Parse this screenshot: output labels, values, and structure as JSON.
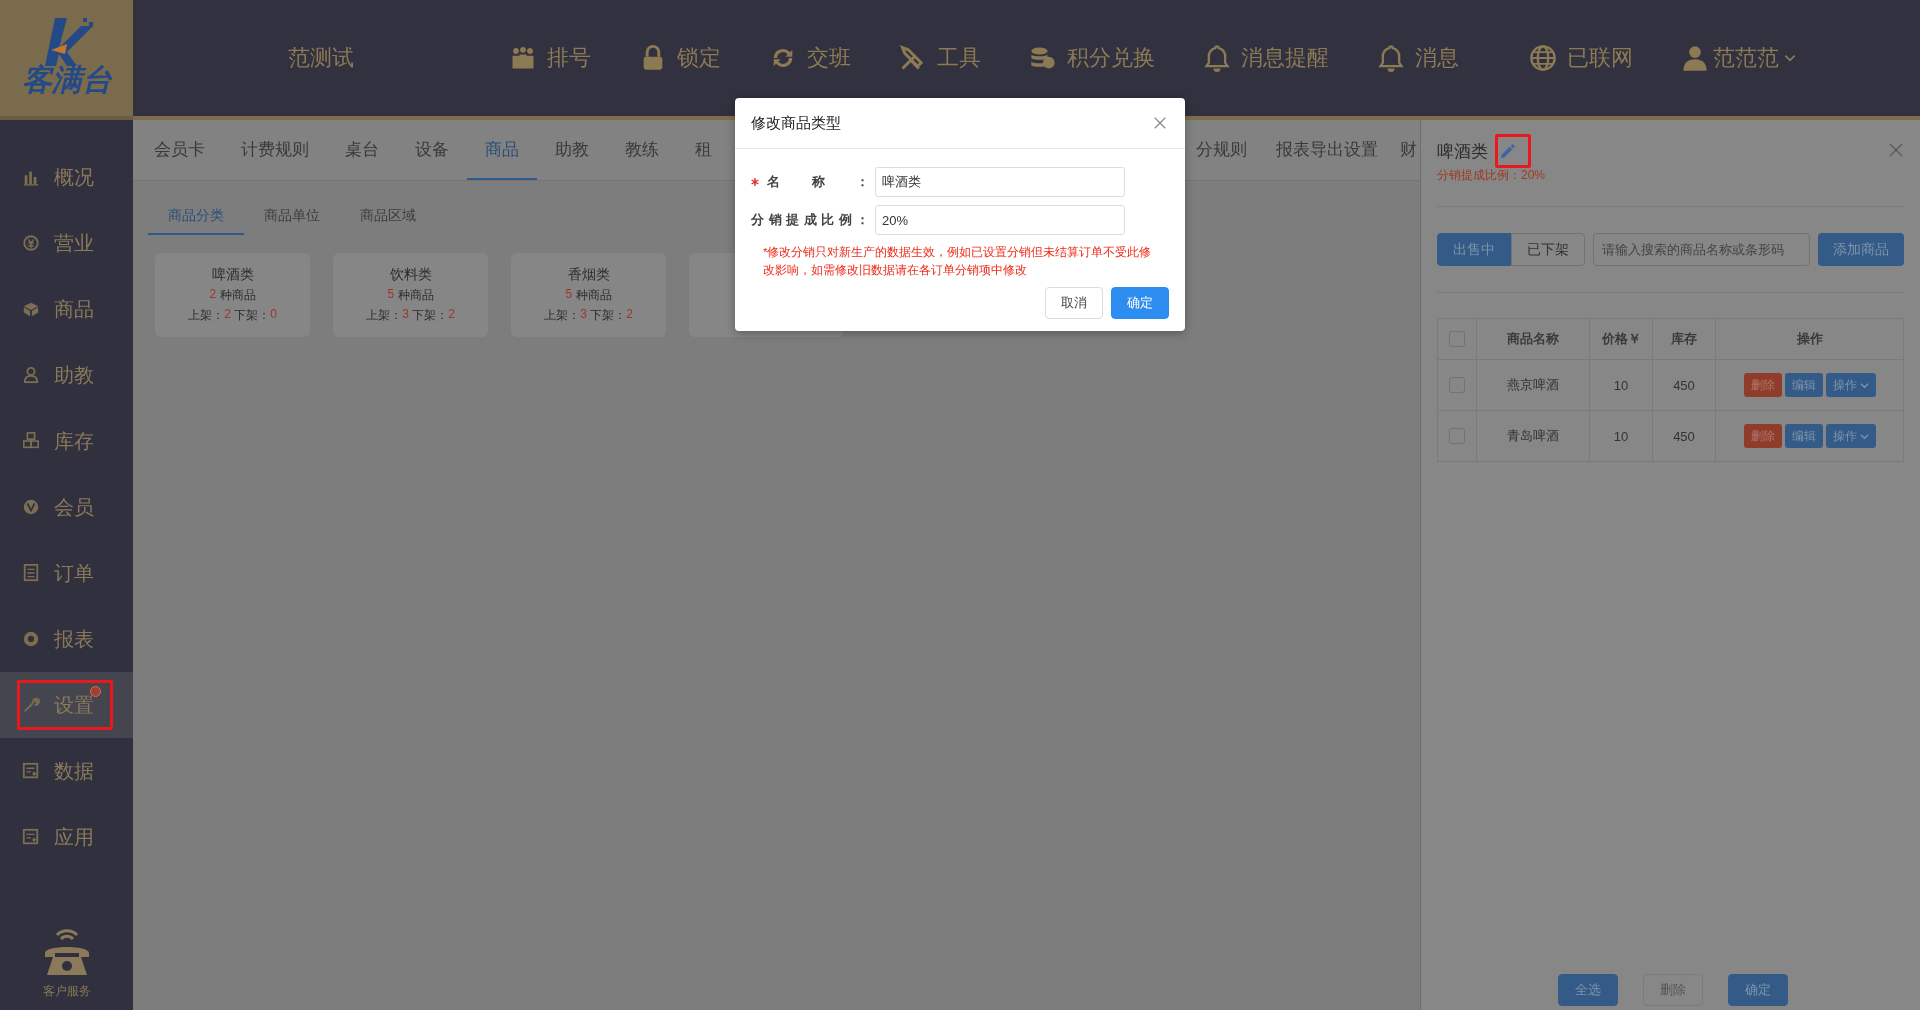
{
  "sidebar": {
    "logo_text": "客满台",
    "items": [
      {
        "label": "概况",
        "selected": false,
        "highlighted": false,
        "badge": false
      },
      {
        "label": "营业",
        "selected": false,
        "highlighted": false,
        "badge": false
      },
      {
        "label": "商品",
        "selected": false,
        "highlighted": false,
        "badge": false
      },
      {
        "label": "助教",
        "selected": false,
        "highlighted": false,
        "badge": false
      },
      {
        "label": "库存",
        "selected": false,
        "highlighted": false,
        "badge": false
      },
      {
        "label": "会员",
        "selected": false,
        "highlighted": false,
        "badge": false
      },
      {
        "label": "订单",
        "selected": false,
        "highlighted": false,
        "badge": false
      },
      {
        "label": "报表",
        "selected": false,
        "highlighted": false,
        "badge": false
      },
      {
        "label": "设置",
        "selected": true,
        "highlighted": true,
        "badge": true
      },
      {
        "label": "数据",
        "selected": false,
        "highlighted": false,
        "badge": false
      },
      {
        "label": "应用",
        "selected": false,
        "highlighted": false,
        "badge": false
      }
    ],
    "support": "客户服务"
  },
  "top_bar": {
    "store_name": "范测试",
    "items": [
      {
        "label": "排号"
      },
      {
        "label": "锁定"
      },
      {
        "label": "交班"
      },
      {
        "label": "工具"
      },
      {
        "label": "积分兑换"
      },
      {
        "label": "消息提醒"
      },
      {
        "label": "消息"
      }
    ],
    "network": "已联网",
    "user": "范范范"
  },
  "tabs": [
    {
      "label": "会员卡",
      "selected": false
    },
    {
      "label": "计费规则",
      "selected": false
    },
    {
      "label": "桌台",
      "selected": false
    },
    {
      "label": "设备",
      "selected": false
    },
    {
      "label": "商品",
      "selected": true
    },
    {
      "label": "助教",
      "selected": false
    },
    {
      "label": "教练",
      "selected": false
    },
    {
      "label": "租",
      "selected": false
    },
    {
      "label": "分规则",
      "selected": false
    },
    {
      "label": "报表导出设置",
      "selected": false
    },
    {
      "label": "财",
      "selected": false
    }
  ],
  "sub_tabs": [
    {
      "label": "商品分类",
      "selected": true
    },
    {
      "label": "商品单位",
      "selected": false
    },
    {
      "label": "商品区域",
      "selected": false
    }
  ],
  "categories": [
    {
      "name": "啤酒类",
      "count": "2",
      "count_label": "种商品",
      "on_label": "上架：",
      "on": "2",
      "off_label": "下架：",
      "off": "0"
    },
    {
      "name": "饮料类",
      "count": "5",
      "count_label": "种商品",
      "on_label": "上架：",
      "on": "3",
      "off_label": "下架：",
      "off": "2"
    },
    {
      "name": "香烟类",
      "count": "5",
      "count_label": "种商品",
      "on_label": "上架：",
      "on": "3",
      "off_label": "下架：",
      "off": "2"
    }
  ],
  "dialog": {
    "title": "修改商品类型",
    "fields": [
      {
        "label": "名称：",
        "required": true,
        "value": "啤酒类"
      },
      {
        "label": "分销提成比例：",
        "required": false,
        "value": "20%"
      }
    ],
    "note": "*修改分销只对新生产的数据生效，例如已设置分销但未结算订单不受此修改影响，如需修改旧数据请在各订单分销项中修改",
    "buttons": [
      {
        "label": "取消",
        "kind": "default"
      },
      {
        "label": "确定",
        "kind": "primary"
      }
    ]
  },
  "panel": {
    "title": "啤酒类",
    "edit_highlighted": true,
    "subtitle": "分销提成比例：20%",
    "status_tabs": [
      {
        "label": "出售中",
        "selected": true
      },
      {
        "label": "已下架",
        "selected": false
      }
    ],
    "search": {
      "placeholder": "请输入搜索的商品名称或条形码"
    },
    "add_button": "添加商品",
    "select_all_checked": false,
    "columns": [
      "商品名称",
      "价格￥",
      "库存",
      "操作"
    ],
    "rows": [
      {
        "checked": false,
        "name": "燕京啤酒",
        "price": "10",
        "stock": "450",
        "actions": [
          {
            "label": "删除",
            "kind": "danger"
          },
          {
            "label": "编辑",
            "kind": "edit"
          },
          {
            "label": "操作",
            "kind": "dropdown"
          }
        ]
      },
      {
        "checked": false,
        "name": "青岛啤酒",
        "price": "10",
        "stock": "450",
        "actions": [
          {
            "label": "删除",
            "kind": "danger"
          },
          {
            "label": "编辑",
            "kind": "edit"
          },
          {
            "label": "操作",
            "kind": "dropdown"
          }
        ]
      }
    ],
    "footer_buttons": [
      {
        "label": "全选",
        "disabled": false
      },
      {
        "label": "删除",
        "disabled": true
      },
      {
        "label": "确定",
        "disabled": false
      }
    ]
  }
}
